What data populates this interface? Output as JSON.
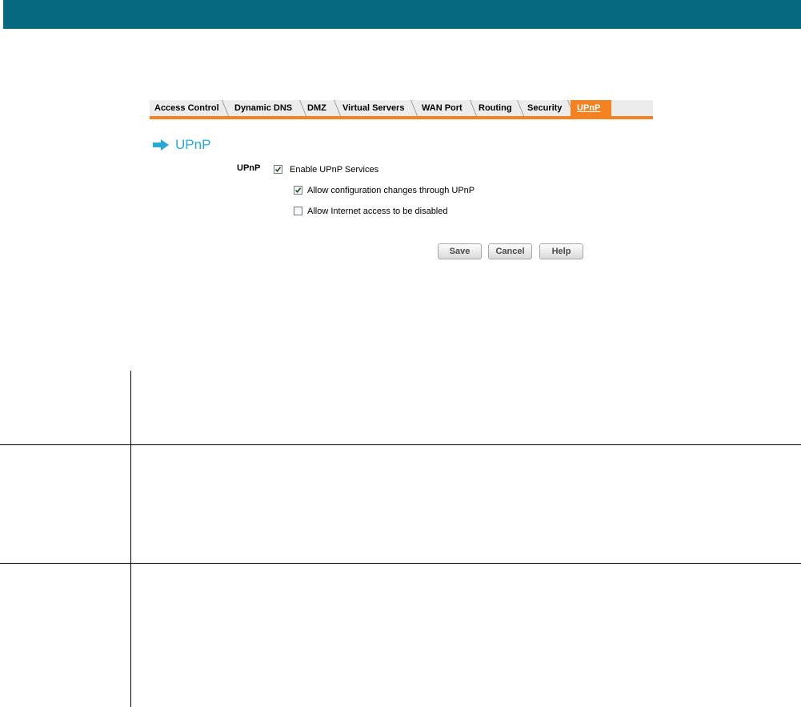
{
  "colors": {
    "header": "#06697f",
    "accent": "#f58220",
    "title": "#27a9d8"
  },
  "tabs": [
    {
      "label": "Access Control",
      "active": false
    },
    {
      "label": "Dynamic DNS",
      "active": false
    },
    {
      "label": "DMZ",
      "active": false
    },
    {
      "label": "Virtual Servers",
      "active": false
    },
    {
      "label": "WAN Port",
      "active": false
    },
    {
      "label": "Routing",
      "active": false
    },
    {
      "label": "Security",
      "active": false
    },
    {
      "label": "UPnP",
      "active": true
    }
  ],
  "page": {
    "title": "UPnP",
    "icon": "arrow-right-icon"
  },
  "form": {
    "label": "UPnP",
    "options": [
      {
        "label": "Enable UPnP Services",
        "checked": true
      },
      {
        "label": "Allow configuration changes through UPnP",
        "checked": true
      },
      {
        "label": "Allow Internet access to be disabled",
        "checked": false
      }
    ]
  },
  "buttons": {
    "save": "Save",
    "cancel": "Cancel",
    "help": "Help"
  }
}
